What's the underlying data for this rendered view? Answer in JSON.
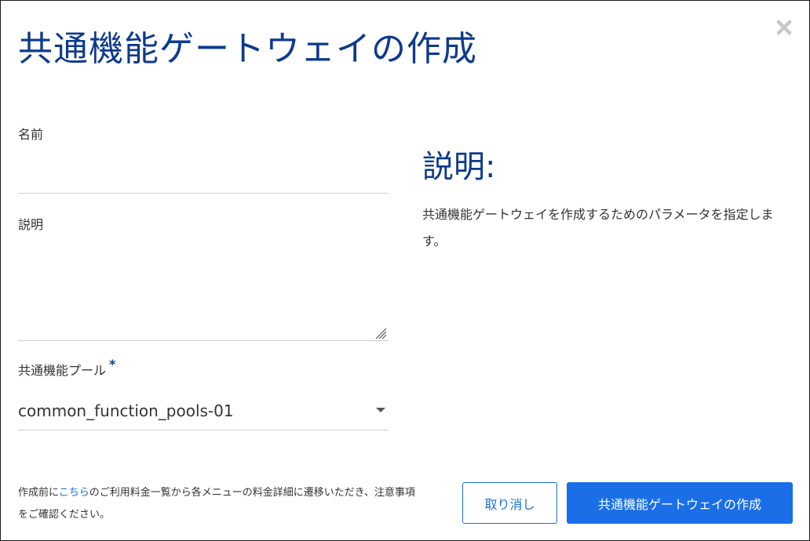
{
  "dialog": {
    "title": "共通機能ゲートウェイの作成",
    "close_icon": "close-icon"
  },
  "form": {
    "name_label": "名前",
    "name_value": "",
    "description_label": "説明",
    "description_value": "",
    "pool_label": "共通機能プール",
    "pool_required_mark": "*",
    "pool_selected": "common_function_pools-01"
  },
  "help": {
    "title": "説明:",
    "text": "共通機能ゲートウェイを作成するためのパラメータを指定します。"
  },
  "footer": {
    "note_prefix": "作成前に",
    "note_link": "こちら",
    "note_suffix": "のご利用料金一覧から各メニューの料金詳細に遷移いただき、注意事項をご確認ください。",
    "cancel_label": "取り消し",
    "create_label": "共通機能ゲートウェイの作成"
  },
  "colors": {
    "title": "#0d3a8c",
    "accent": "#1a6fe8",
    "link": "#1a6fd6"
  }
}
